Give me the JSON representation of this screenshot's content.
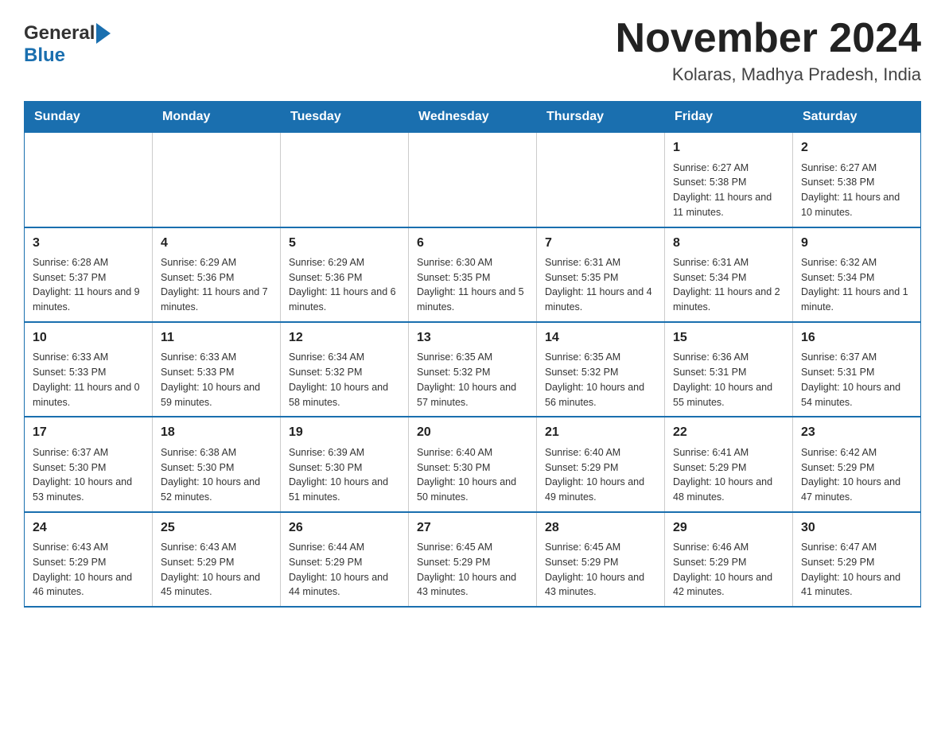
{
  "header": {
    "logo": {
      "general": "General",
      "arrow_symbol": "▶",
      "blue": "Blue"
    },
    "title": "November 2024",
    "subtitle": "Kolaras, Madhya Pradesh, India"
  },
  "days_of_week": [
    "Sunday",
    "Monday",
    "Tuesday",
    "Wednesday",
    "Thursday",
    "Friday",
    "Saturday"
  ],
  "weeks": [
    [
      {
        "day": "",
        "info": ""
      },
      {
        "day": "",
        "info": ""
      },
      {
        "day": "",
        "info": ""
      },
      {
        "day": "",
        "info": ""
      },
      {
        "day": "",
        "info": ""
      },
      {
        "day": "1",
        "info": "Sunrise: 6:27 AM\nSunset: 5:38 PM\nDaylight: 11 hours and 11 minutes."
      },
      {
        "day": "2",
        "info": "Sunrise: 6:27 AM\nSunset: 5:38 PM\nDaylight: 11 hours and 10 minutes."
      }
    ],
    [
      {
        "day": "3",
        "info": "Sunrise: 6:28 AM\nSunset: 5:37 PM\nDaylight: 11 hours and 9 minutes."
      },
      {
        "day": "4",
        "info": "Sunrise: 6:29 AM\nSunset: 5:36 PM\nDaylight: 11 hours and 7 minutes."
      },
      {
        "day": "5",
        "info": "Sunrise: 6:29 AM\nSunset: 5:36 PM\nDaylight: 11 hours and 6 minutes."
      },
      {
        "day": "6",
        "info": "Sunrise: 6:30 AM\nSunset: 5:35 PM\nDaylight: 11 hours and 5 minutes."
      },
      {
        "day": "7",
        "info": "Sunrise: 6:31 AM\nSunset: 5:35 PM\nDaylight: 11 hours and 4 minutes."
      },
      {
        "day": "8",
        "info": "Sunrise: 6:31 AM\nSunset: 5:34 PM\nDaylight: 11 hours and 2 minutes."
      },
      {
        "day": "9",
        "info": "Sunrise: 6:32 AM\nSunset: 5:34 PM\nDaylight: 11 hours and 1 minute."
      }
    ],
    [
      {
        "day": "10",
        "info": "Sunrise: 6:33 AM\nSunset: 5:33 PM\nDaylight: 11 hours and 0 minutes."
      },
      {
        "day": "11",
        "info": "Sunrise: 6:33 AM\nSunset: 5:33 PM\nDaylight: 10 hours and 59 minutes."
      },
      {
        "day": "12",
        "info": "Sunrise: 6:34 AM\nSunset: 5:32 PM\nDaylight: 10 hours and 58 minutes."
      },
      {
        "day": "13",
        "info": "Sunrise: 6:35 AM\nSunset: 5:32 PM\nDaylight: 10 hours and 57 minutes."
      },
      {
        "day": "14",
        "info": "Sunrise: 6:35 AM\nSunset: 5:32 PM\nDaylight: 10 hours and 56 minutes."
      },
      {
        "day": "15",
        "info": "Sunrise: 6:36 AM\nSunset: 5:31 PM\nDaylight: 10 hours and 55 minutes."
      },
      {
        "day": "16",
        "info": "Sunrise: 6:37 AM\nSunset: 5:31 PM\nDaylight: 10 hours and 54 minutes."
      }
    ],
    [
      {
        "day": "17",
        "info": "Sunrise: 6:37 AM\nSunset: 5:30 PM\nDaylight: 10 hours and 53 minutes."
      },
      {
        "day": "18",
        "info": "Sunrise: 6:38 AM\nSunset: 5:30 PM\nDaylight: 10 hours and 52 minutes."
      },
      {
        "day": "19",
        "info": "Sunrise: 6:39 AM\nSunset: 5:30 PM\nDaylight: 10 hours and 51 minutes."
      },
      {
        "day": "20",
        "info": "Sunrise: 6:40 AM\nSunset: 5:30 PM\nDaylight: 10 hours and 50 minutes."
      },
      {
        "day": "21",
        "info": "Sunrise: 6:40 AM\nSunset: 5:29 PM\nDaylight: 10 hours and 49 minutes."
      },
      {
        "day": "22",
        "info": "Sunrise: 6:41 AM\nSunset: 5:29 PM\nDaylight: 10 hours and 48 minutes."
      },
      {
        "day": "23",
        "info": "Sunrise: 6:42 AM\nSunset: 5:29 PM\nDaylight: 10 hours and 47 minutes."
      }
    ],
    [
      {
        "day": "24",
        "info": "Sunrise: 6:43 AM\nSunset: 5:29 PM\nDaylight: 10 hours and 46 minutes."
      },
      {
        "day": "25",
        "info": "Sunrise: 6:43 AM\nSunset: 5:29 PM\nDaylight: 10 hours and 45 minutes."
      },
      {
        "day": "26",
        "info": "Sunrise: 6:44 AM\nSunset: 5:29 PM\nDaylight: 10 hours and 44 minutes."
      },
      {
        "day": "27",
        "info": "Sunrise: 6:45 AM\nSunset: 5:29 PM\nDaylight: 10 hours and 43 minutes."
      },
      {
        "day": "28",
        "info": "Sunrise: 6:45 AM\nSunset: 5:29 PM\nDaylight: 10 hours and 43 minutes."
      },
      {
        "day": "29",
        "info": "Sunrise: 6:46 AM\nSunset: 5:29 PM\nDaylight: 10 hours and 42 minutes."
      },
      {
        "day": "30",
        "info": "Sunrise: 6:47 AM\nSunset: 5:29 PM\nDaylight: 10 hours and 41 minutes."
      }
    ]
  ]
}
